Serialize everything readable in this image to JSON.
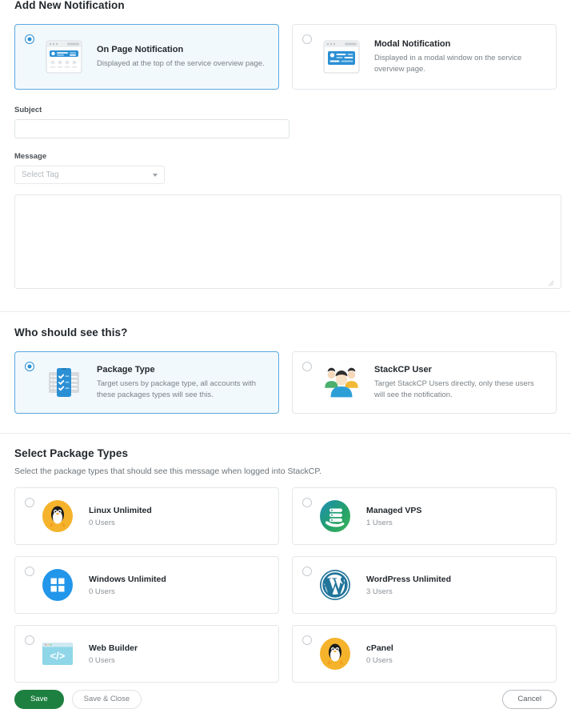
{
  "header": {
    "title": "Add New Notification"
  },
  "notification_types": {
    "options": [
      {
        "label": "On Page Notification",
        "description": "Displayed at the top of the service overview page.",
        "icon": "on-page-notification-icon",
        "selected": true
      },
      {
        "label": "Modal Notification",
        "description": "Displayed in a modal window on the service overview page.",
        "icon": "modal-notification-icon",
        "selected": false
      }
    ]
  },
  "form": {
    "subject": {
      "label": "Subject",
      "value": "",
      "placeholder": ""
    },
    "message": {
      "label": "Message",
      "tag_select_value": "Select Tag",
      "body_value": "",
      "body_placeholder": ""
    }
  },
  "audience": {
    "title": "Who should see this?",
    "options": [
      {
        "label": "Package Type",
        "description": "Target users by package type, all accounts with these packages types will see this.",
        "icon": "package-checklist-icon",
        "selected": true
      },
      {
        "label": "StackCP User",
        "description": "Target StackCP Users directly, only these users will see the notification.",
        "icon": "users-group-icon",
        "selected": false
      }
    ]
  },
  "package_types": {
    "title": "Select Package Types",
    "description": "Select the package types that should see this message when logged into StackCP.",
    "items": [
      {
        "name": "Linux Unlimited",
        "users": "0 Users",
        "icon": "linux-penguin-icon",
        "selected": false
      },
      {
        "name": "Managed VPS",
        "users": "1 Users",
        "icon": "managed-vps-icon",
        "selected": false
      },
      {
        "name": "Windows Unlimited",
        "users": "0 Users",
        "icon": "windows-icon",
        "selected": false
      },
      {
        "name": "WordPress Unlimited",
        "users": "3 Users",
        "icon": "wordpress-icon",
        "selected": false
      },
      {
        "name": "Web Builder",
        "users": "0 Users",
        "icon": "web-builder-icon",
        "selected": false
      },
      {
        "name": "cPanel",
        "users": "0 Users",
        "icon": "cpanel-penguin-icon",
        "selected": false
      }
    ]
  },
  "footer": {
    "save_label": "Save",
    "save_close_label": "Save & Close",
    "cancel_label": "Cancel"
  },
  "colors": {
    "accent_blue": "#2b8fd4",
    "selected_card_bg": "#f2f9fd",
    "save_green": "#1e8040",
    "linux_yellow": "#f5b32c",
    "vps_teal": "#23a06b",
    "windows_blue": "#2196ea",
    "wordpress_blue": "#21759b",
    "webbuilder_blue": "#8ed6e8"
  }
}
